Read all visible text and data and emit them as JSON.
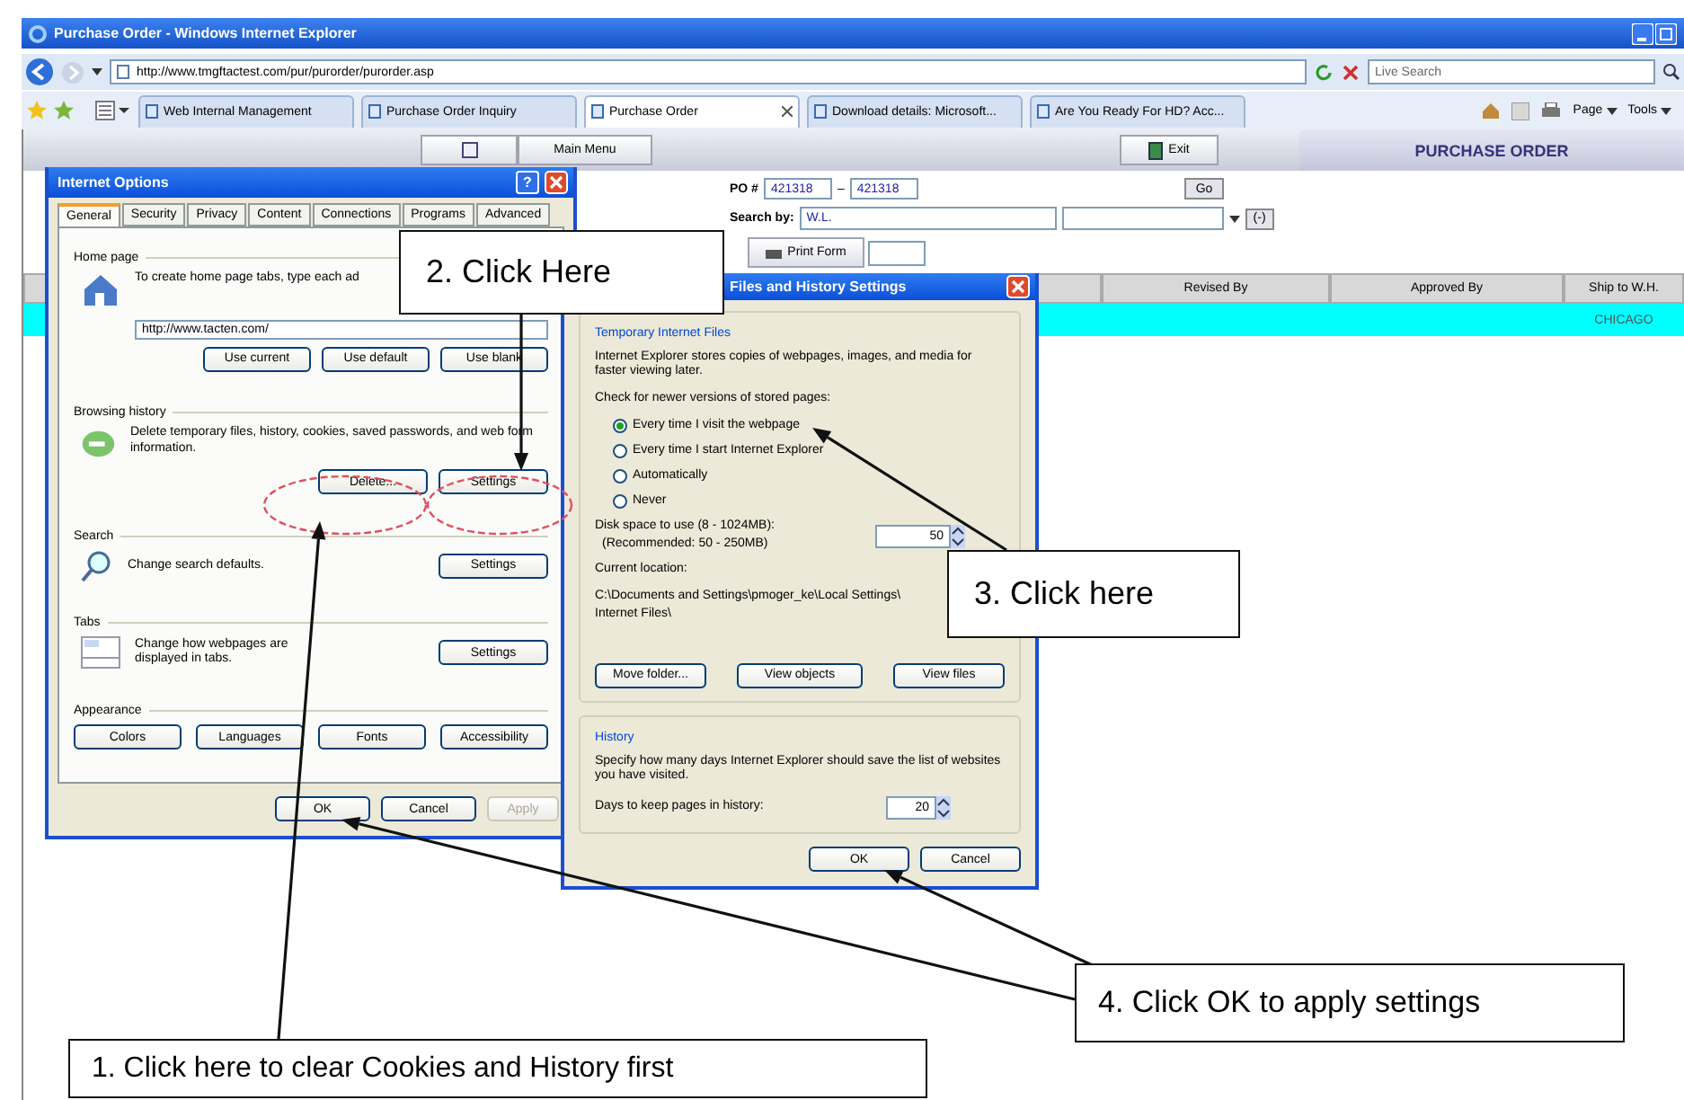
{
  "browser": {
    "title": "Purchase Order - Windows Internet Explorer",
    "address": "http://www.tmgftactest.com/pur/purorder/purorder.asp",
    "search_placeholder": "Live Search",
    "tabs": [
      {
        "label": "Web Internal Management",
        "selected": false
      },
      {
        "label": "Purchase Order Inquiry",
        "selected": false
      },
      {
        "label": "Purchase Order",
        "selected": true
      },
      {
        "label": "Download details: Microsoft...",
        "selected": false
      },
      {
        "label": "Are You Ready For HD? Acc...",
        "selected": false
      }
    ],
    "tools": [
      "Page",
      "Tools"
    ]
  },
  "page": {
    "menu_button": "Main Menu",
    "exit_button": "Exit",
    "heading": "PURCHASE ORDER",
    "search": {
      "po_label": "PO #",
      "po_from": "421318",
      "dash": "–",
      "po_to": "421318",
      "go": "Go",
      "search_by_label": "Search by:",
      "search_by_value": "W.L.",
      "clear": "(-)",
      "print": "Print Form"
    },
    "table": {
      "columns": [
        "Revised By",
        "Approved By",
        "Ship to W.H."
      ],
      "rows": [
        {
          "ship_to": "CHICAGO",
          "selected": true
        }
      ]
    }
  },
  "internet_options": {
    "title": "Internet Options",
    "help_glyph": "?",
    "tabs": [
      {
        "label": "General",
        "selected": true
      },
      {
        "label": "Security",
        "selected": false
      },
      {
        "label": "Privacy",
        "selected": false
      },
      {
        "label": "Content",
        "selected": false
      },
      {
        "label": "Connections",
        "selected": false
      },
      {
        "label": "Programs",
        "selected": false
      },
      {
        "label": "Advanced",
        "selected": false
      }
    ],
    "home_page": {
      "label": "Home page",
      "text": "To create home page tabs, type each ad",
      "url": "http://www.tacten.com/",
      "buttons": [
        "Use current",
        "Use default",
        "Use blank"
      ]
    },
    "browsing_history": {
      "label": "Browsing history",
      "text": "Delete temporary files, history, cookies, saved passwords, and web form information.",
      "buttons": [
        "Delete...",
        "Settings"
      ]
    },
    "search": {
      "label": "Search",
      "text": "Change search defaults.",
      "button": "Settings"
    },
    "tabs_section": {
      "label": "Tabs",
      "text": "Change how webpages are displayed in tabs.",
      "button": "Settings"
    },
    "appearance": {
      "label": "Appearance",
      "buttons": [
        "Colors",
        "Languages",
        "Fonts",
        "Accessibility"
      ]
    },
    "footer": [
      {
        "label": "OK",
        "disabled": false
      },
      {
        "label": "Cancel",
        "disabled": false
      },
      {
        "label": "Apply",
        "disabled": true
      }
    ]
  },
  "history_settings": {
    "title": "Files and History Settings",
    "temp_files": {
      "label": "Temporary Internet Files",
      "text": "Internet Explorer stores copies of webpages, images, and media for faster viewing later.",
      "check_label": "Check for newer versions of stored pages:",
      "radios": [
        {
          "label": "Every time I visit the webpage",
          "selected": true
        },
        {
          "label": "Every time I start Internet Explorer",
          "selected": false
        },
        {
          "label": "Automatically",
          "selected": false
        },
        {
          "label": "Never",
          "selected": false
        }
      ],
      "disk_label": "Disk space to use (8 - 1024MB):",
      "disk_note": "(Recommended: 50 - 250MB)",
      "disk_value": "50",
      "location_label": "Current location:",
      "location_lines": [
        "C:\\Documents and Settings\\pmoger_ke\\Local Settings\\",
        "Internet Files\\"
      ],
      "buttons": [
        "Move folder...",
        "View objects",
        "View files"
      ]
    },
    "history": {
      "label": "History",
      "text": "Specify how many days Internet Explorer should save the list of websites you have visited.",
      "days_label": "Days to keep pages in history:",
      "days_value": "20"
    },
    "footer": [
      "OK",
      "Cancel"
    ]
  },
  "callouts": [
    {
      "text": "2. Click Here"
    },
    {
      "text": "3. Click here"
    },
    {
      "text": "4. Click OK to apply settings"
    },
    {
      "text": "1. Click here to clear Cookies and History first"
    }
  ]
}
